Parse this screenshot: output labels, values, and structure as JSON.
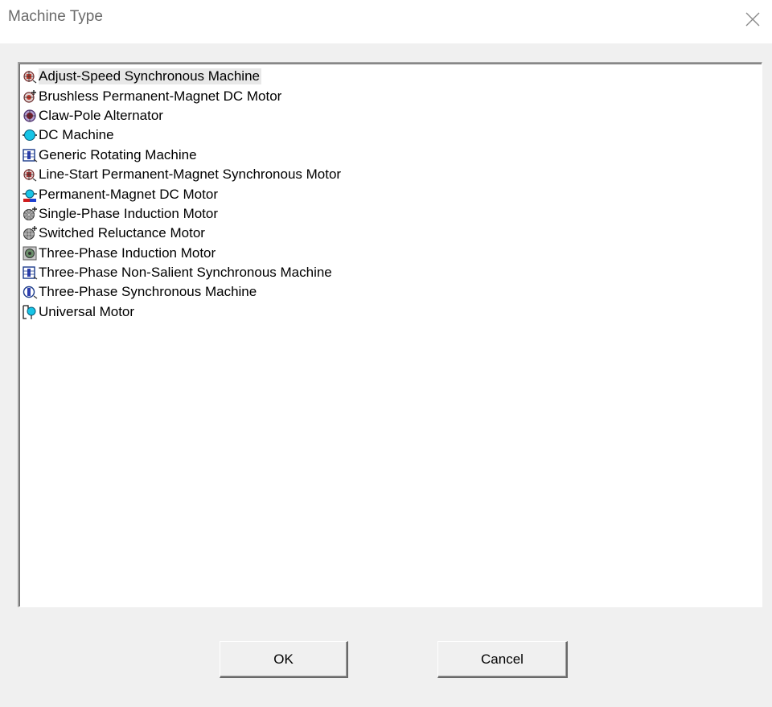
{
  "window": {
    "title": "Machine Type",
    "close_icon": "close-icon"
  },
  "machine_list": {
    "selected_index": 0,
    "items": [
      {
        "label": "Adjust-Speed  Synchronous Machine",
        "icon": "adjust-speed-synchronous-machine-icon"
      },
      {
        "label": "Brushless Permanent-Magnet DC Motor",
        "icon": "brushless-pm-dc-motor-icon"
      },
      {
        "label": "Claw-Pole Alternator",
        "icon": "claw-pole-alternator-icon"
      },
      {
        "label": "DC Machine",
        "icon": "dc-machine-icon"
      },
      {
        "label": "Generic Rotating Machine",
        "icon": "generic-rotating-machine-icon"
      },
      {
        "label": "Line-Start Permanent-Magnet Synchronous Motor",
        "icon": "line-start-pm-synchronous-motor-icon"
      },
      {
        "label": "Permanent-Magnet DC Motor",
        "icon": "pm-dc-motor-icon"
      },
      {
        "label": "Single-Phase Induction Motor",
        "icon": "single-phase-induction-motor-icon"
      },
      {
        "label": "Switched Reluctance Motor",
        "icon": "switched-reluctance-motor-icon"
      },
      {
        "label": "Three-Phase Induction Motor",
        "icon": "three-phase-induction-motor-icon"
      },
      {
        "label": "Three-Phase Non-Salient Synchronous Machine",
        "icon": "three-phase-non-salient-synchronous-machine-icon"
      },
      {
        "label": "Three-Phase Synchronous Machine",
        "icon": "three-phase-synchronous-machine-icon"
      },
      {
        "label": "Universal Motor",
        "icon": "universal-motor-icon"
      }
    ]
  },
  "buttons": {
    "ok_label": "OK",
    "cancel_label": "Cancel"
  }
}
